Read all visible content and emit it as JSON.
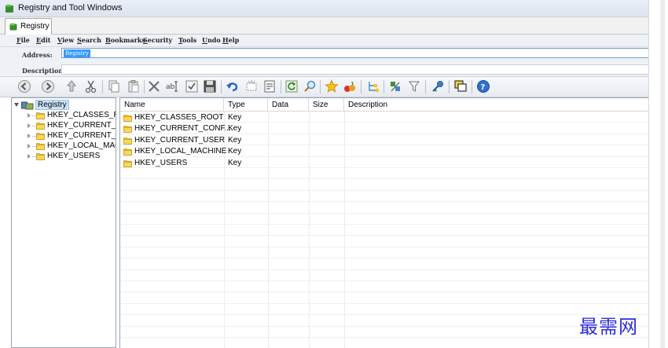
{
  "window": {
    "title": "Registry and Tool Windows"
  },
  "tabs": [
    {
      "label": "Registry"
    }
  ],
  "menu": [
    "File",
    "Edit",
    "View",
    "Search",
    "Bookmarks",
    "Security",
    "Tools",
    "Undo",
    "Help"
  ],
  "address": {
    "label": "Address:",
    "value": "Registry"
  },
  "description": {
    "label": "Description",
    "value": ""
  },
  "toolbar": {
    "buttons": [
      "back-icon",
      "forward-icon",
      "up-icon",
      "cut-icon",
      "copy-icon",
      "paste-icon",
      "delete-icon",
      "rename-icon",
      "check-icon",
      "save-icon",
      "undo-icon",
      "new-key-icon",
      "properties-icon",
      "refresh-icon",
      "find-icon",
      "bookmark-star-icon",
      "tools-icon",
      "tree-icon",
      "registry-tool-icon",
      "filter-icon",
      "key-icon",
      "windows-icon",
      "help-icon"
    ]
  },
  "tree": {
    "root": "Registry",
    "nodes": [
      "HKEY_CLASSES_ROOT",
      "HKEY_CURRENT_CONFIG",
      "HKEY_CURRENT_USER",
      "HKEY_LOCAL_MACHINE",
      "HKEY_USERS"
    ]
  },
  "list": {
    "columns": [
      "Name",
      "Type",
      "Data",
      "Size",
      "Description"
    ],
    "rows": [
      {
        "name": "HKEY_CLASSES_ROOT",
        "type": "Key"
      },
      {
        "name": "HKEY_CURRENT_CONF...",
        "type": "Key"
      },
      {
        "name": "HKEY_CURRENT_USER",
        "type": "Key"
      },
      {
        "name": "HKEY_LOCAL_MACHINE",
        "type": "Key"
      },
      {
        "name": "HKEY_USERS",
        "type": "Key"
      }
    ]
  },
  "watermark": "最需网",
  "colors": {
    "accent": "#3399ff",
    "folder": "#f2c233",
    "watermark": "#2d2dd8"
  }
}
